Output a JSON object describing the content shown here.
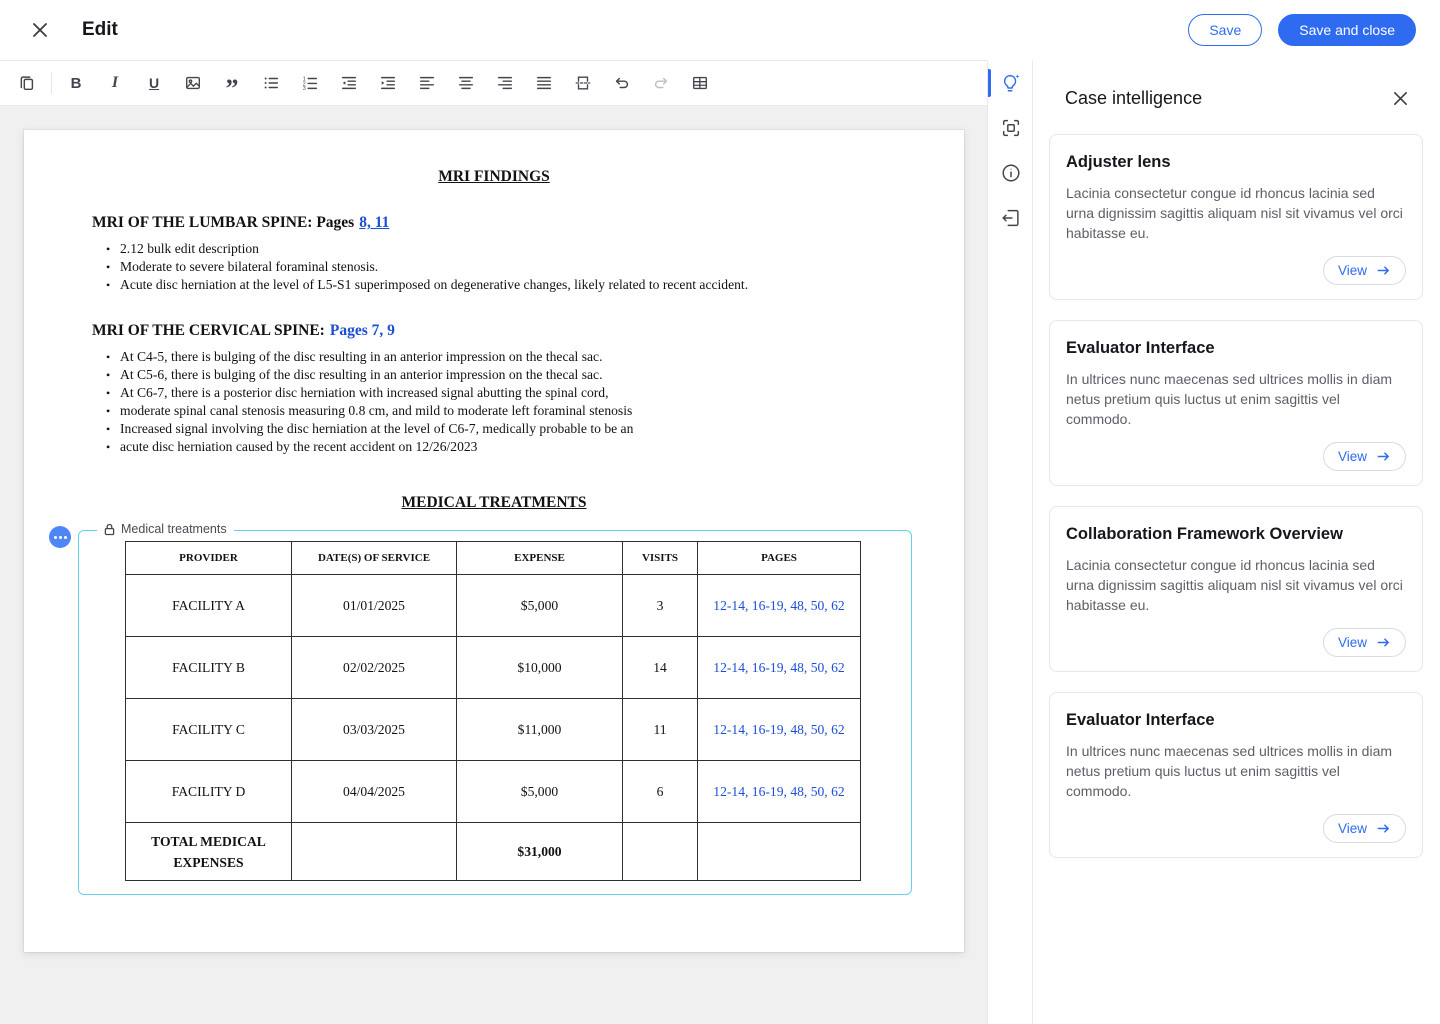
{
  "header": {
    "title": "Edit",
    "save_label": "Save",
    "save_and_close_label": "Save and close"
  },
  "toolbar": {
    "icons": [
      "copy",
      "bold",
      "italic",
      "underline",
      "image",
      "quote",
      "bulleted-list",
      "numbered-list",
      "decrease-indent",
      "increase-indent",
      "align-left",
      "align-center",
      "align-right",
      "align-justify",
      "page-break",
      "undo",
      "redo",
      "table"
    ]
  },
  "doc": {
    "title1": "MRI FINDINGS",
    "lumbar": {
      "heading": "MRI OF THE LUMBAR SPINE: Pages",
      "pages_link": "8, 11",
      "bullets": [
        "2.12 bulk edit description",
        "Moderate to severe bilateral foraminal stenosis.",
        "Acute disc herniation at the level of L5-S1 superimposed on degenerative changes, likely related to recent accident."
      ]
    },
    "cervical": {
      "heading": "MRI OF THE CERVICAL SPINE:",
      "pages_link": "Pages 7, 9",
      "bullets": [
        "At C4-5, there is bulging of the disc resulting in an anterior impression on the thecal sac.",
        "At C5-6, there is bulging of the disc resulting in an anterior impression on the thecal sac.",
        "At C6-7, there is a posterior disc herniation with increased signal abutting the spinal cord,",
        "moderate spinal canal stenosis measuring 0.8 cm, and mild to moderate left foraminal stenosis",
        "Increased signal involving the disc herniation at the level of C6-7, medically probable to be an",
        "acute disc herniation caused by the recent accident on 12/26/2023"
      ]
    },
    "title2": "MEDICAL TREATMENTS",
    "block": {
      "label": "Medical treatments"
    },
    "table": {
      "headers": [
        "PROVIDER",
        "DATE(S) OF SERVICE",
        "EXPENSE",
        "VISITS",
        "PAGES"
      ],
      "rows": [
        {
          "provider": "FACILITY A",
          "date": "01/01/2025",
          "expense": "$5,000",
          "visits": "3",
          "pages": "12-14, 16-19, 48, 50, 62"
        },
        {
          "provider": "FACILITY B",
          "date": "02/02/2025",
          "expense": "$10,000",
          "visits": "14",
          "pages": "12-14, 16-19, 48, 50, 62"
        },
        {
          "provider": "FACILITY C",
          "date": "03/03/2025",
          "expense": "$11,000",
          "visits": "11",
          "pages": "12-14, 16-19, 48, 50, 62"
        },
        {
          "provider": "FACILITY D",
          "date": "04/04/2025",
          "expense": "$5,000",
          "visits": "6",
          "pages": "12-14, 16-19, 48, 50, 62"
        }
      ],
      "total_row": {
        "label": "TOTAL MEDICAL EXPENSES",
        "expense": "$31,000"
      }
    }
  },
  "panel": {
    "title": "Case intelligence",
    "cards": [
      {
        "title": "Adjuster lens",
        "body": "Lacinia consectetur congue id rhoncus lacinia sed urna dignissim sagittis aliquam nisl sit vivamus vel orci habitasse eu.",
        "action": "View"
      },
      {
        "title": "Evaluator Interface",
        "body": "In ultrices nunc maecenas sed ultrices mollis in diam netus pretium quis luctus ut enim sagittis vel commodo.",
        "action": "View"
      },
      {
        "title": "Collaboration Framework Overview",
        "body": "Lacinia consectetur congue id rhoncus lacinia sed urna dignissim sagittis aliquam nisl sit vivamus vel orci habitasse eu.",
        "action": "View"
      },
      {
        "title": "Evaluator Interface",
        "body": "In ultrices nunc maecenas sed ultrices mollis in diam netus pretium quis luctus ut enim sagittis vel commodo.",
        "action": "View"
      }
    ]
  },
  "colors": {
    "accent_blue": "#2e6bf0",
    "link_blue": "#1d4ed8",
    "selection_cyan": "#63d2ef"
  }
}
